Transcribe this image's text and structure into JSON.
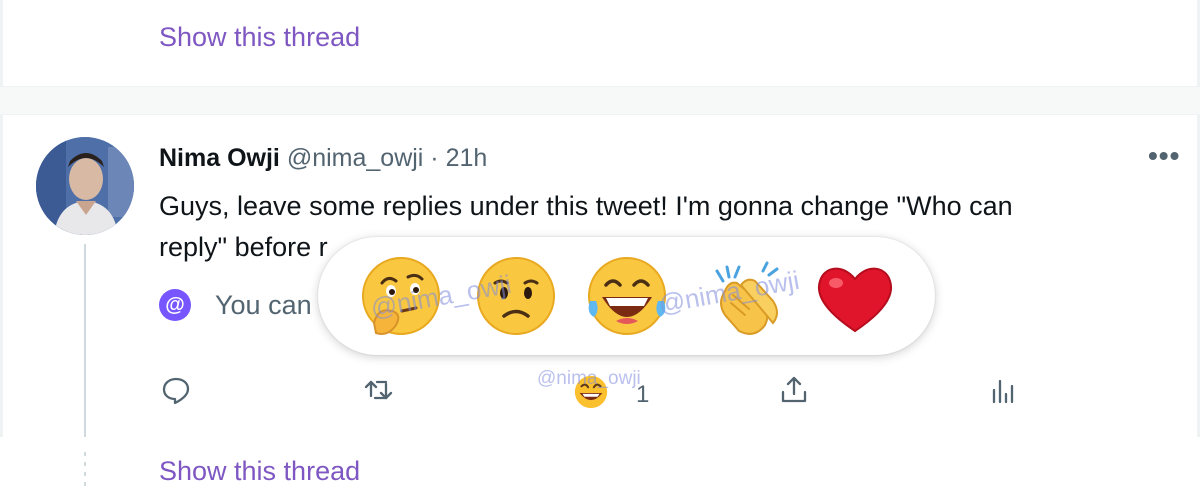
{
  "top_link": {
    "label": "Show this thread"
  },
  "tweet": {
    "author_name": "Nima Owji",
    "handle_time": "@nima_owji · 21h",
    "more": "•••",
    "text_line1": "Guys, leave some replies under this tweet! I'm gonna change \"Who can",
    "text_line2": "reply\" before r",
    "restrict_text": "You can",
    "reaction_count": "1"
  },
  "reactions": {
    "items": [
      {
        "name": "thinking-face"
      },
      {
        "name": "frowning-face"
      },
      {
        "name": "laughing-tears-face"
      },
      {
        "name": "clapping-hands"
      },
      {
        "name": "red-heart"
      }
    ]
  },
  "watermark": {
    "text": "@nima_owji"
  },
  "bottom_link": {
    "label": "Show this thread"
  },
  "colors": {
    "link": "#7e57c2",
    "badge": "#7856ff",
    "heart": "#e0142a"
  }
}
